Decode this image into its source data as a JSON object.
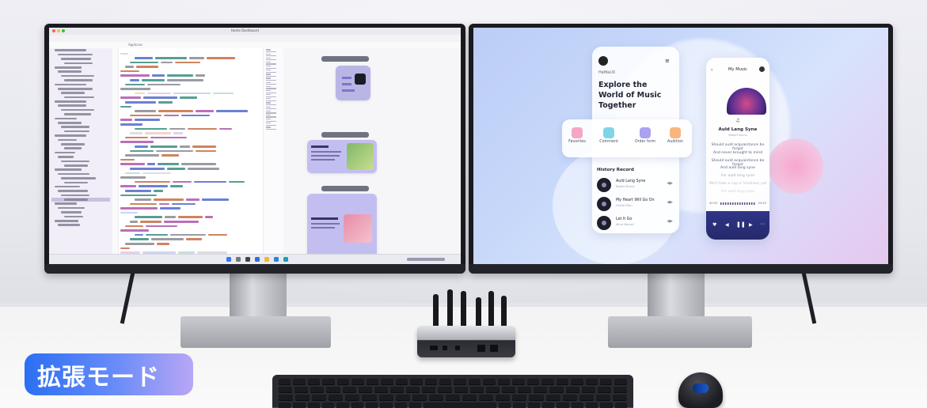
{
  "badge": {
    "label": "拡張モード"
  },
  "ide": {
    "window_title": "Home Dashboard",
    "source_header": "AppIcons"
  },
  "music_app": {
    "brand": "HeMaUX",
    "headline": "Explore the World of Music Together",
    "categories": [
      "Favorites",
      "Comment",
      "Order form",
      "Audition"
    ],
    "history_title": "History Record",
    "history": [
      {
        "title": "Auld Lang Syne",
        "artist": "Robert Burns"
      },
      {
        "title": "My Heart Will Go On",
        "artist": "Celine Dion"
      },
      {
        "title": "Let It Go",
        "artist": "Idina Menzel"
      }
    ],
    "player": {
      "screen_title": "My Music",
      "song": "Auld Lang Syne",
      "artist": "Robert Burns",
      "lyrics": [
        "Should auld acquaintance be forgot",
        "And never brought to mind",
        "Should auld acquaintance be forgot",
        "And auld lang syne",
        "For auld lang syne",
        "We'll take a cup o' kindness yet",
        "For auld lang syne"
      ],
      "time_current": "00:55",
      "time_total": "03:45"
    }
  },
  "colors": {
    "badge_start": "#2b6ff3",
    "badge_end": "#b9a6f5",
    "monitor_bezel": "#1a1b20",
    "widget_purple": "#b9b6e6",
    "player_dark": "#2a2e72"
  }
}
